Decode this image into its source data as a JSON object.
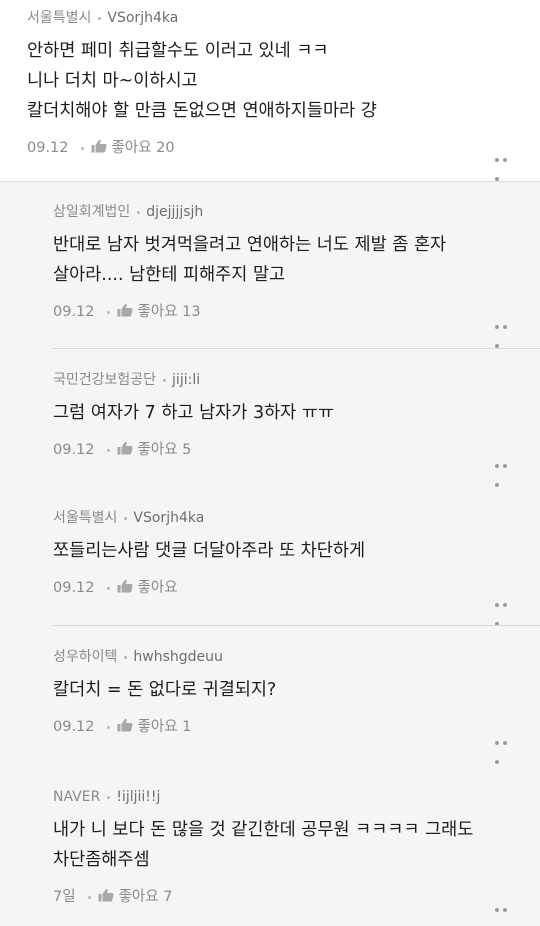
{
  "top_comment": {
    "region": "서울특별시",
    "user_id": "VSorjh4ka",
    "lines": [
      "안하면 페미 취급할수도 이러고 있네 ㅋㅋ",
      "니나 더치 마~이하시고",
      "칼더치해야 할 만큼 돈없으면 연애하지들마라 걍"
    ],
    "date": "09.12",
    "likes": "좋아요 20"
  },
  "replies": [
    {
      "region": "삼일회계법인",
      "user_id": "djejjjjsjh",
      "lines": [
        "반대로 남자 벗겨먹을려고 연애하는 너도 제발 좀 혼자",
        "살아라.... 남한테 피해주지 말고"
      ],
      "date": "09.12",
      "likes": "좋아요 13"
    },
    {
      "region": "국민건강보험공단",
      "user_id": "jiji:li",
      "lines": [
        "그럼 여자가 7 하고 남자가 3하자 ㅠㅠ"
      ],
      "date": "09.12",
      "likes": "좋아요 5"
    },
    {
      "region": "서울특별시",
      "user_id": "VSorjh4ka",
      "lines": [
        "쪼들리는사람 댓글 더달아주라 또 차단하게"
      ],
      "date": "09.12",
      "likes": "좋아요"
    },
    {
      "region": "성우하이텍",
      "user_id": "hwhshgdeuu",
      "lines": [
        "칼더치 = 돈 없다로 귀결되지?"
      ],
      "date": "09.12",
      "likes": "좋아요 1"
    },
    {
      "region": "NAVER",
      "user_id": "!ijljii!!j",
      "lines": [
        "내가 니 보다 돈 많을 것 같긴한데 공무원 ㅋㅋㅋㅋ 그래도",
        "차단좀해주셈"
      ],
      "date": "7일",
      "likes": "좋아요 7"
    }
  ],
  "icons": {
    "like": "thumbs-up-icon",
    "more": "more-dots-icon"
  },
  "colors": {
    "meta_text": "#8a8a8a",
    "reply_bg": "#f5f5f5",
    "divider": "#d8d8d8"
  }
}
